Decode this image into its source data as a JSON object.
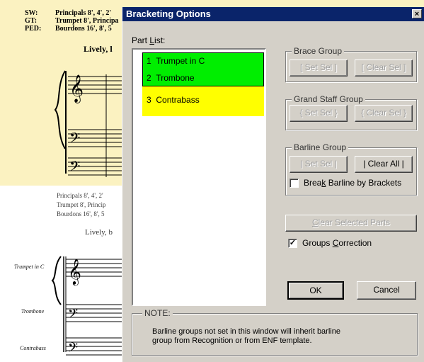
{
  "score": {
    "registration": {
      "sw_label": "SW:",
      "sw_value": "Principals 8', 4', 2'",
      "gt_label": "GT:",
      "gt_value": "Trumpet 8', Principa",
      "ped_label": "PED:",
      "ped_value": "Bourdons 16', 8', 5"
    },
    "tempo": "Lively, l",
    "lower": {
      "line1": "Principals 8', 4', 2'",
      "line2": "Trumpet 8', Princip",
      "line3": "Bourdons 16', 8', 5",
      "tempo": "Lively, b",
      "instruments": [
        "Trumpet in C",
        "Trombone",
        "Contrabass"
      ]
    }
  },
  "dialog": {
    "title": "Bracketing Options",
    "close_glyph": "×",
    "part_list_label_pre": "Part ",
    "part_list_label_u": "L",
    "part_list_label_post": "ist:",
    "parts": [
      {
        "num": "1",
        "name": "Trumpet in C",
        "color": "#00ee00"
      },
      {
        "num": "2",
        "name": "Trombone",
        "color": "#00ee00"
      },
      {
        "num": "3",
        "name": "Contrabass",
        "color": "#ffff00"
      }
    ],
    "brace_group": {
      "title": "Brace Group",
      "set": "[ Set Sel ]",
      "clear": "[ Clear Sel ]"
    },
    "grand_staff_group": {
      "title": "Grand Staff Group",
      "set": "{ Set Sel }",
      "clear": "{ Clear Sel }"
    },
    "barline_group": {
      "title": "Barline Group",
      "set": "| Set Sel |",
      "clear": "| Clear All |",
      "break_pre": "Brea",
      "break_u": "k",
      "break_post": " Barline by Brackets",
      "break_checked": false
    },
    "clear_selected": {
      "pre": "",
      "u": "C",
      "post": "lear Selected Parts"
    },
    "groups_correction": {
      "pre": "Groups ",
      "u": "C",
      "post": "orrection",
      "checked": true
    },
    "ok": "OK",
    "cancel": "Cancel",
    "note_title": "NOTE:",
    "note_line1": "Barline groups not set in this window will inherit barline",
    "note_line2": "group from Recognition or from ENF template."
  }
}
